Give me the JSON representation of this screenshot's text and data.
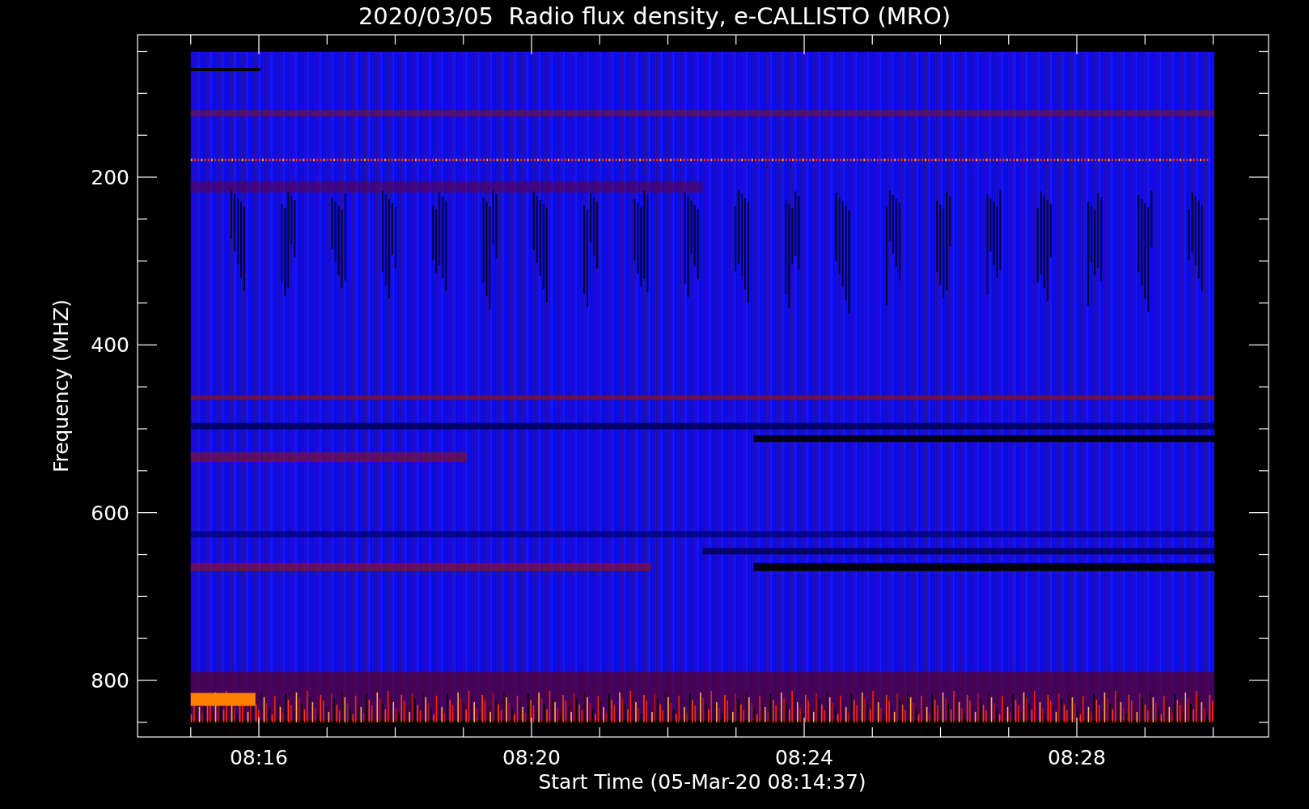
{
  "title": "2020/03/05  Radio flux density, e-CALLISTO (MRO)",
  "ylabel": "Frequency (MHZ)",
  "xlabel": "Start Time (05-Mar-20 08:14:37)",
  "yticks": [
    "200",
    "400",
    "600",
    "800"
  ],
  "xticks": [
    "08:16",
    "08:20",
    "08:24",
    "08:28"
  ]
}
